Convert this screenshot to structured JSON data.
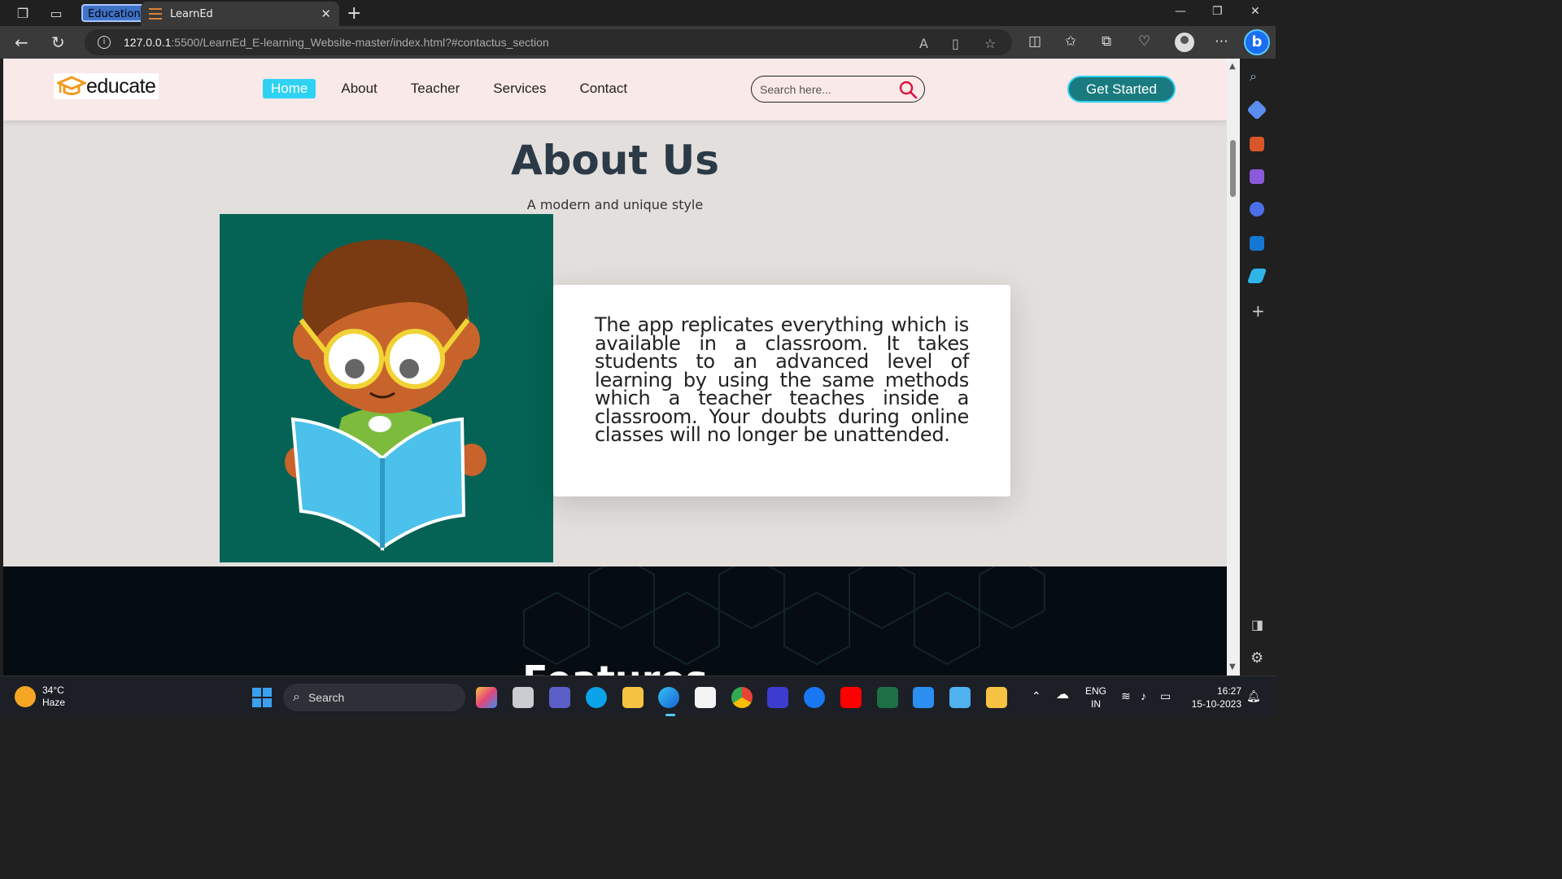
{
  "browser": {
    "tab_group_label": "Education",
    "active_tab_title": "LearnEd",
    "url_host": "127.0.0.1",
    "url_path": ":5500/LearnEd_E-learning_Website-master/index.html?#contactus_section"
  },
  "site": {
    "logo_text": "educate",
    "nav": [
      {
        "label": "Home",
        "active": true
      },
      {
        "label": "About",
        "active": false
      },
      {
        "label": "Teacher",
        "active": false
      },
      {
        "label": "Services",
        "active": false
      },
      {
        "label": "Contact",
        "active": false
      }
    ],
    "search_placeholder": "Search here...",
    "cta_label": "Get Started",
    "colors": {
      "header_bg": "#f9e9e8",
      "nav_active": "#2fd2f3",
      "cta_bg": "#197b7f",
      "illustration_bg": "#046355"
    }
  },
  "about": {
    "title": "About Us",
    "subtitle": "A modern and unique style",
    "body": "The app replicates everything which is available in a classroom. It takes students to an advanced level of learning by using the same methods which a teacher teaches inside a classroom. Your doubts during online classes will no longer be unattended."
  },
  "features": {
    "title": "Features"
  },
  "taskbar": {
    "weather_temp": "34°C",
    "weather_desc": "Haze",
    "search_label": "Search",
    "lang_top": "ENG",
    "lang_bottom": "IN",
    "time": "16:27",
    "date": "15-10-2023"
  }
}
